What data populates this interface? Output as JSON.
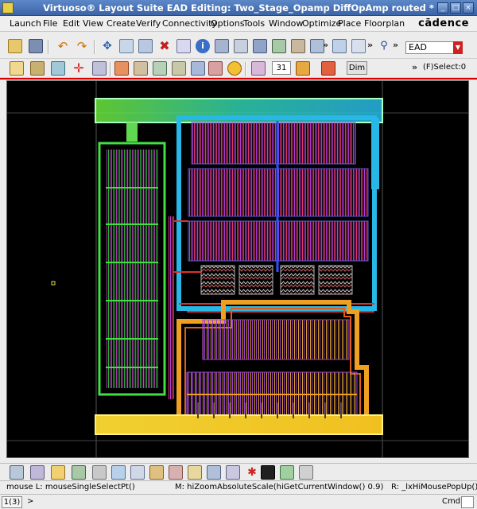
{
  "window": {
    "title": "Virtuoso® Layout Suite EAD Editing: Two_Stage_Opamp DiffOpAmp routed *"
  },
  "menu": {
    "items": [
      "Launch",
      "File",
      "Edit",
      "View",
      "Create",
      "Verify",
      "Connectivity",
      "Options",
      "Tools",
      "Window",
      "Optimize",
      "Place",
      "Floorplan"
    ],
    "logo": "cādence"
  },
  "toolbar1": {
    "more": "»",
    "search_value": "EAD"
  },
  "toolbar2": {
    "more": "»",
    "grid_value": "31",
    "dim_label": "Dim",
    "select_status": "(F)Select:0"
  },
  "status": {
    "left": "mouse L: mouseSingleSelectPt()",
    "middle": "M: hiZoomAbsoluteScale(hiGetCurrentWindow() 0.9)",
    "right": "R: _lxHiMousePopUp()"
  },
  "cmdline": {
    "count": "1(3)",
    "prompt": ">",
    "cmd_label": "Cmd:"
  },
  "colors": {
    "canvas": "#000000",
    "accent_red": "#d60000",
    "titlebar": "#3b64a8"
  }
}
